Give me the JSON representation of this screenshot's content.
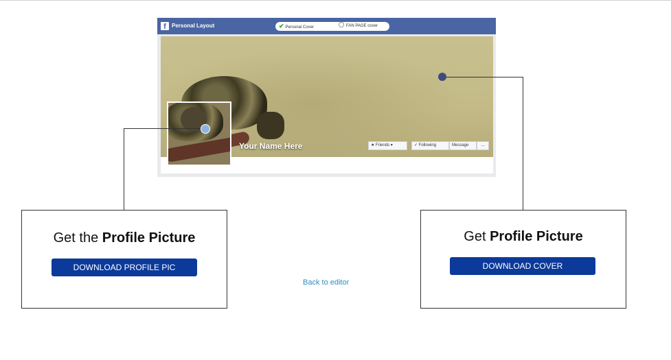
{
  "preview": {
    "title": "Personal Layout",
    "logo_letter": "f",
    "mode_options": [
      "Personal Cover",
      "FAN PAGE cover"
    ],
    "selected_mode": "Personal Cover",
    "name_placeholder": "Your Name Here",
    "buttons": {
      "friends": "Friends",
      "following": "Following",
      "message": "Message",
      "more": "..."
    }
  },
  "profile_box": {
    "title_prefix": "Get the",
    "title_bold": "Profile Picture",
    "button": "DOWNLOAD PROFILE PIC"
  },
  "cover_box": {
    "title_prefix": "Get",
    "title_bold": "Profile Picture",
    "button": "DOWNLOAD COVER"
  },
  "back_link": "Back to editor",
  "colors": {
    "fb_blue": "#4a65a4",
    "button_blue": "#0c3a9a",
    "link": "#2b8fc3"
  }
}
